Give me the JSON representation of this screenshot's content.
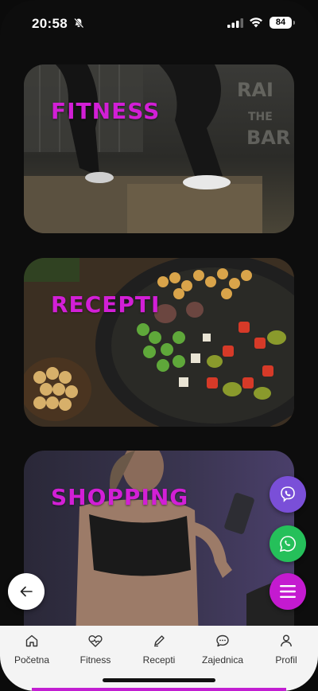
{
  "status_bar": {
    "time": "20:58",
    "battery": "84"
  },
  "cards": [
    {
      "title": "FITNESS"
    },
    {
      "title": "RECEPTI"
    },
    {
      "title": "SHOPPING"
    }
  ],
  "tabs": [
    {
      "label": "Početna",
      "icon": "home-icon"
    },
    {
      "label": "Fitness",
      "icon": "heart-pulse-icon"
    },
    {
      "label": "Recepti",
      "icon": "pencil-icon"
    },
    {
      "label": "Zajednica",
      "icon": "chat-icon"
    },
    {
      "label": "Profil",
      "icon": "user-icon"
    }
  ],
  "colors": {
    "accent": "#d21fd6",
    "viber": "#7a4fd8",
    "whatsapp": "#25c05a",
    "menu": "#c41ad0"
  }
}
